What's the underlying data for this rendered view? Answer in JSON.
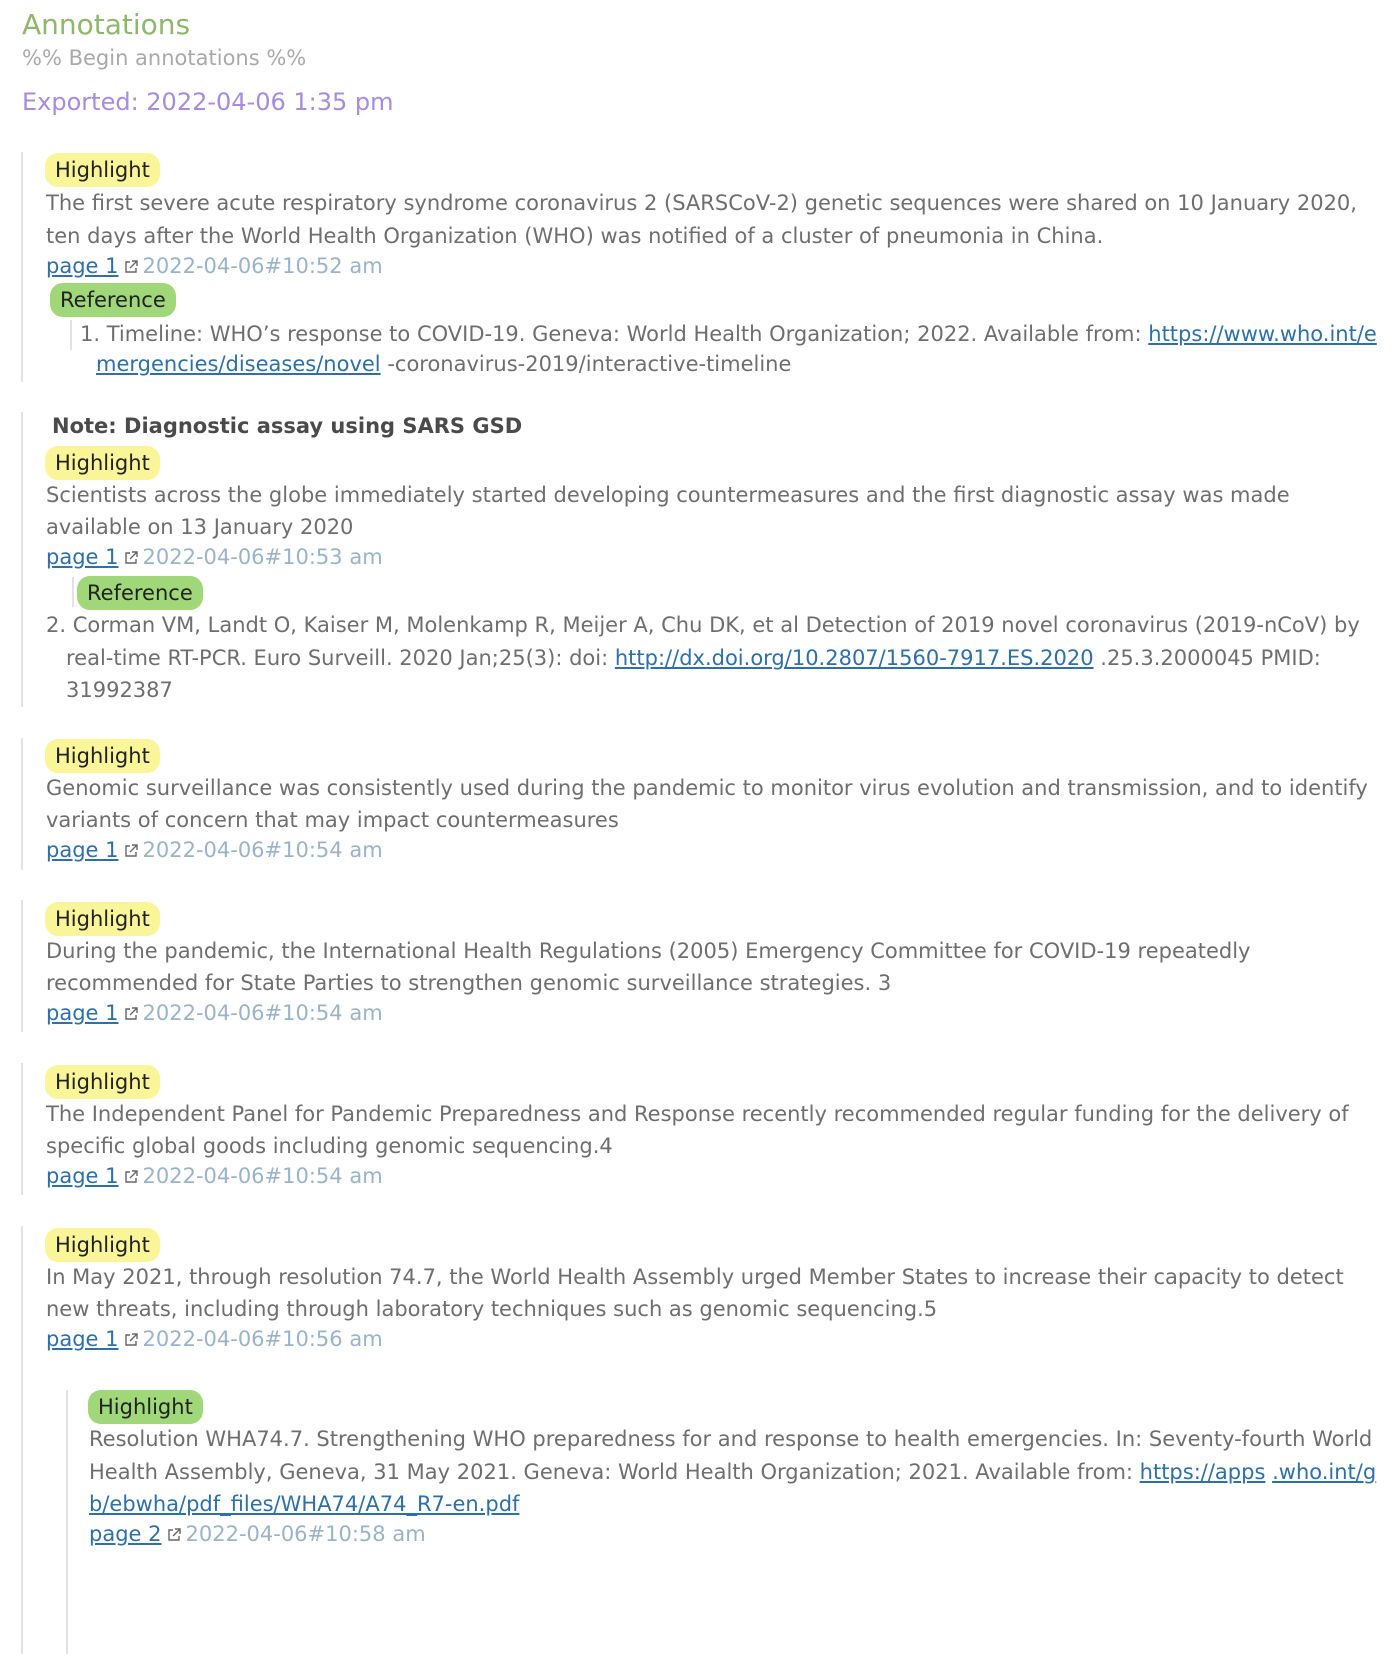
{
  "header": {
    "title": "Annotations",
    "begin_comment": "%% Begin annotations %%",
    "exported": "Exported: 2022-04-06 1:35 pm"
  },
  "blocks": [
    {
      "tag": "Highlight",
      "text_lines": [
        "The first severe acute respiratory syndrome coronavirus 2 (SARSCoV-2) genetic sequences were shared on 10 January 2020,",
        "ten days after the World Health Organization (WHO) was notified of a cluster of pneumonia in China."
      ],
      "page_link": "page 1",
      "timestamp": "2022-04-06#10:52 am",
      "reference_tag": "Reference",
      "reference_prefix": "1. Timeline: WHO’s response to COVID-19. Geneva: World Health Organization; 2022. Available from: ",
      "reference_link1": "https://www.who.int/e",
      "reference_link2": "mergencies/diseases/novel",
      "reference_suffix": " -coronavirus-2019/interactive-timeline"
    },
    {
      "note_label": "Note",
      "note_text": "Diagnostic assay using SARS GSD",
      "tag": "Highlight",
      "text_lines": [
        "Scientists across the globe immediately started developing countermeasures and the first diagnostic assay was made",
        "available on 13 January 2020"
      ],
      "page_link": "page 1",
      "timestamp": "2022-04-06#10:53 am",
      "reference_tag": "Reference",
      "reference_line1": "2. Corman VM, Landt O, Kaiser M, Molenkamp R, Meijer A, Chu DK, et al Detection of 2019 novel coronavirus (2019-nCoV) by",
      "reference_line2_prefix": "real-time RT-PCR. Euro Surveill. 2020 Jan;25(3): doi: ",
      "reference_link": "http://dx.doi.org/10.2807/1560-7917.ES.2020",
      "reference_line2_suffix": " .25.3.2000045 PMID:",
      "reference_line3": "31992387"
    },
    {
      "tag": "Highlight",
      "text_lines": [
        "Genomic surveillance was consistently used during the pandemic to monitor virus evolution and transmission, and to identify",
        "variants of concern that may impact countermeasures"
      ],
      "page_link": "page 1",
      "timestamp": "2022-04-06#10:54 am"
    },
    {
      "tag": "Highlight",
      "text_lines": [
        "During the pandemic, the International Health Regulations (2005) Emergency Committee for COVID-19 repeatedly",
        "recommended for State Parties to strengthen genomic surveillance strategies. 3"
      ],
      "page_link": "page 1",
      "timestamp": "2022-04-06#10:54 am"
    },
    {
      "tag": "Highlight",
      "text_lines": [
        "The Independent Panel for Pandemic Preparedness and Response recently recommended regular funding for the delivery of",
        "specific global goods including genomic sequencing.4"
      ],
      "page_link": "page 1",
      "timestamp": "2022-04-06#10:54 am"
    },
    {
      "tag": "Highlight",
      "text_lines": [
        "In May 2021, through resolution 74.7, the World Health Assembly urged Member States to increase their capacity to detect",
        "new threats, including through laboratory techniques such as genomic sequencing.5"
      ],
      "page_link": "page 1",
      "timestamp": "2022-04-06#10:56 am"
    },
    {
      "tag": "Highlight",
      "text_line1": "Resolution WHA74.7. Strengthening WHO preparedness for and response to health emergencies. In: Seventy-fourth World",
      "text_line2_prefix": "Health Assembly, Geneva, 31 May 2021. Geneva: World Health Organization; 2021. Available from: ",
      "link_a": "https://apps",
      "link_b": ".who.int/g",
      "link_c": "b/ebwha/pdf_files/WHA74/A74_R7-en.pdf",
      "page_link": "page 2",
      "timestamp": "2022-04-06#10:58 am"
    }
  ]
}
